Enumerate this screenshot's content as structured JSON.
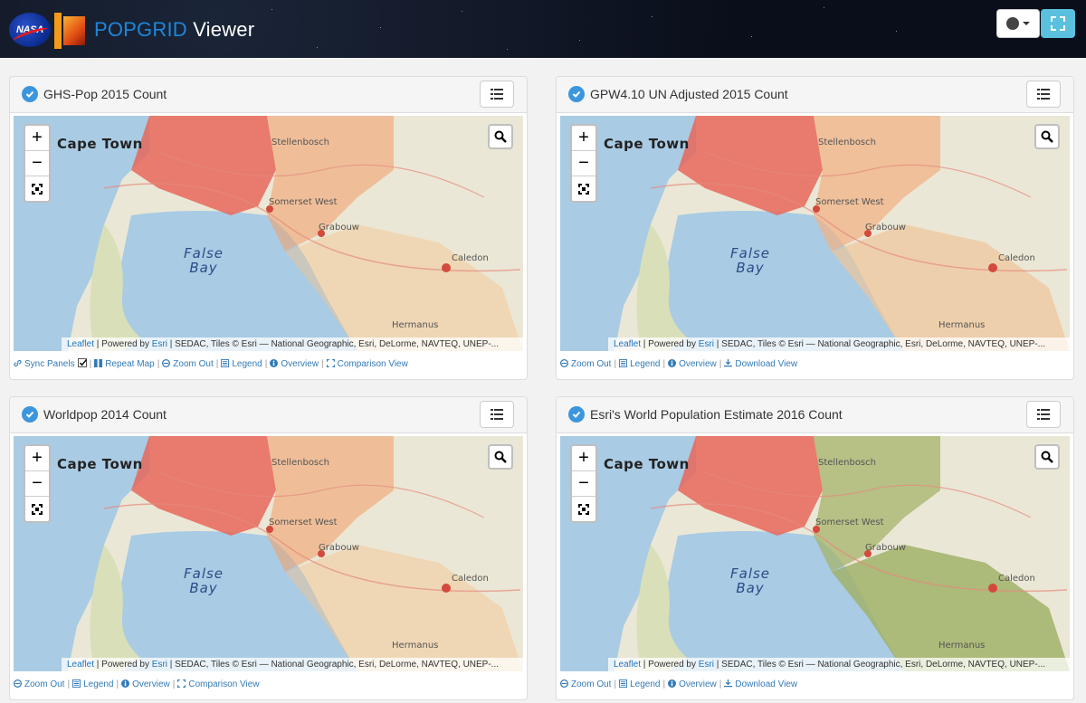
{
  "header": {
    "nasa_logo": "NASA",
    "sedac_logo": "SEDAC",
    "title_main": "POPGRID",
    "title_sub": "Viewer"
  },
  "map_labels": {
    "city": "Cape Town",
    "stellenbosch": "Stellenbosch",
    "somerset": "Somerset West",
    "grabouw": "Grabouw",
    "caledon": "Caledon",
    "hermanus": "Hermanus",
    "bay_1": "False",
    "bay_2": "Bay"
  },
  "attribution": {
    "leaflet": "Leaflet",
    "powered": " | Powered by ",
    "esri": "Esri",
    "rest": " | SEDAC, Tiles © Esri — National Geographic, Esri, DeLorme, NAVTEQ, UNEP-..."
  },
  "panels": [
    {
      "title": "GHS-Pop 2015 Count",
      "links": [
        "Sync Panels",
        "Repeat Map",
        "Zoom Out",
        "Legend",
        "Overview",
        "Comparison View"
      ]
    },
    {
      "title": "GPW4.10 UN Adjusted 2015 Count",
      "links": [
        "Zoom Out",
        "Legend",
        "Overview",
        "Download View"
      ]
    },
    {
      "title": "Worldpop 2014 Count",
      "links": [
        "Zoom Out",
        "Legend",
        "Overview",
        "Comparison View"
      ]
    },
    {
      "title": "Esri's World Population Estimate 2016 Count",
      "links": [
        "Zoom Out",
        "Legend",
        "Overview",
        "Download View"
      ]
    }
  ],
  "zoom": {
    "plus": "+",
    "minus": "−"
  },
  "colors": {
    "accent": "#1d87d9",
    "link": "#337ab7",
    "ocean": "#a9cbe4",
    "land": "#ebe7d6",
    "pop_low": "#f3c48e",
    "pop_high": "#e8675c"
  }
}
